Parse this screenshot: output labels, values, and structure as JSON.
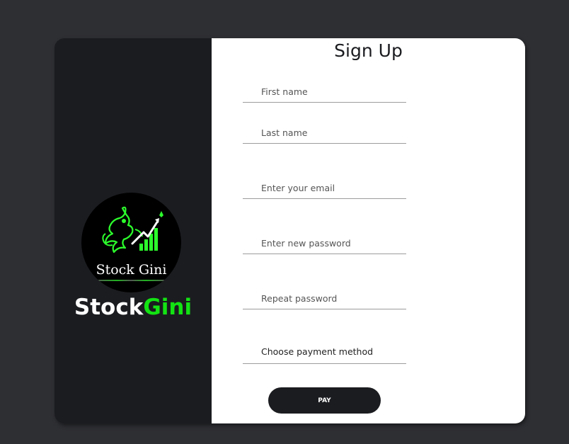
{
  "brand": {
    "logo_text_first": "Stock",
    "logo_text_second": "Gini",
    "name_first": "Stock",
    "name_second": "Gini",
    "accent_color": "#13e313"
  },
  "form": {
    "title": "Sign Up",
    "first_name_placeholder": "First name",
    "last_name_placeholder": "Last name",
    "email_placeholder": "Enter your email",
    "password_placeholder": "Enter new password",
    "repeat_password_placeholder": "Repeat password",
    "payment_label": "Choose payment method",
    "pay_label": "PAY"
  }
}
